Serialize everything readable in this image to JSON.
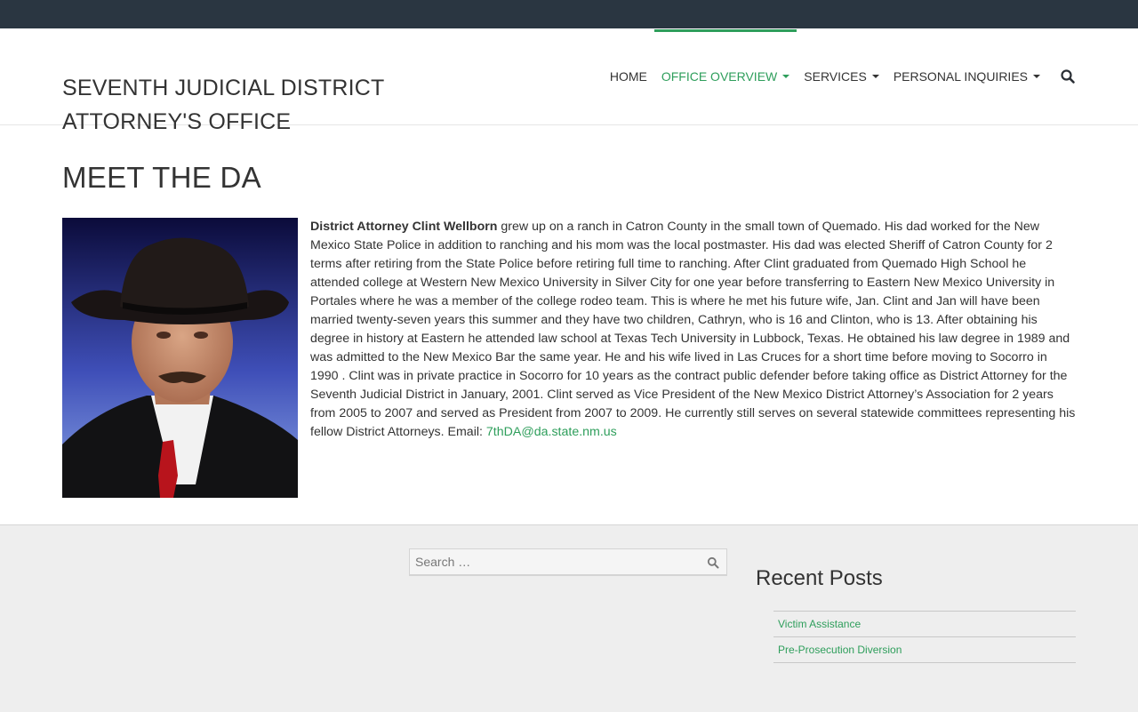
{
  "site": {
    "title_line1": "SEVENTH JUDICIAL DISTRICT",
    "title_line2": "ATTORNEY'S OFFICE"
  },
  "nav": {
    "items": [
      {
        "label": "HOME"
      },
      {
        "label": "OFFICE OVERVIEW"
      },
      {
        "label": "SERVICES"
      },
      {
        "label": "PERSONAL INQUIRIES"
      }
    ],
    "active_color": "#2e9e5b"
  },
  "page": {
    "title": "MEET THE DA",
    "bio_lead": "District Attorney Clint Wellborn",
    "bio_text": " grew up on a ranch in Catron County in the small town of Quemado. His dad worked for the New Mexico State Police in addition to ranching and his mom was the local postmaster. His dad was elected Sheriff of Catron County for 2 terms after retiring from the State Police before retiring full time to ranching. After Clint graduated from Quemado High School he attended college at Western New Mexico University in Silver City for one year before transferring to Eastern New Mexico University in Portales where he was a member of the college rodeo team. This is where he met his future wife, Jan. Clint and Jan will have been married twenty-seven years this summer and they have two children, Cathryn, who is 16 and Clinton, who is 13. After obtaining his degree in history at Eastern he attended law school at Texas Tech University in Lubbock, Texas. He obtained his law degree in 1989 and was admitted to the New Mexico Bar the same year. He and his wife lived in Las Cruces for a short time before moving to Socorro in 1990 . Clint was in private practice in Socorro for 10 years as the contract public defender before taking office as District Attorney for the Seventh Judicial District in January, 2001. Clint served as Vice President of the New Mexico District Attorney’s Association for 2 years from 2005 to 2007 and served as President from 2007 to 2009. He currently still serves on several statewide committees representing his fellow District Attorneys. Email: ",
    "email": "7thDA@da.state.nm.us"
  },
  "footer": {
    "search_placeholder": "Search …",
    "recent_title": "Recent Posts",
    "recent_posts": [
      {
        "label": "Victim Assistance"
      },
      {
        "label": "Pre-Prosecution Diversion"
      }
    ]
  },
  "icons": {
    "search": "search-icon"
  }
}
